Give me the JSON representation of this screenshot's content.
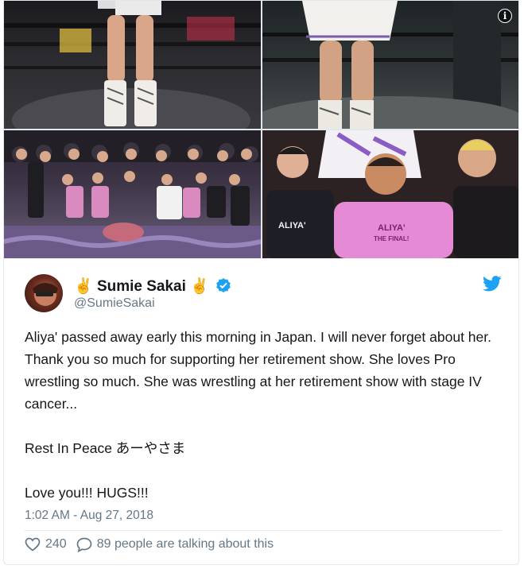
{
  "media": {
    "info_icon": "info-icon",
    "photos": [
      "photo-wrestler-boots-ring",
      "photo-wrestler-legs-ring",
      "photo-group-ring",
      "photo-ceremony-crowd"
    ],
    "shirt_text": "ALIYA' THE FINAL!"
  },
  "user": {
    "name": "Sumie Sakai",
    "handle": "@SumieSakai",
    "name_emoji": "✌",
    "verified_icon": "verified-badge-icon",
    "brand_icon": "twitter-bird-icon",
    "colors": {
      "brand": "#1da1f2",
      "emoji": "#f4b400"
    }
  },
  "tweet": {
    "paragraphs": [
      "Aliya' passed away early this morning in Japan. I will never forget about her. Thank you so much for supporting her retirement show. She loves Pro wrestling so much. She was wrestling at her retirement show with stage IV cancer...",
      "Rest In Peace あーやさま",
      "Love you!!! HUGS!!!"
    ],
    "timestamp": "1:02 AM - Aug 27, 2018"
  },
  "actions": {
    "likes": "240",
    "talking": "89 people are talking about this"
  }
}
